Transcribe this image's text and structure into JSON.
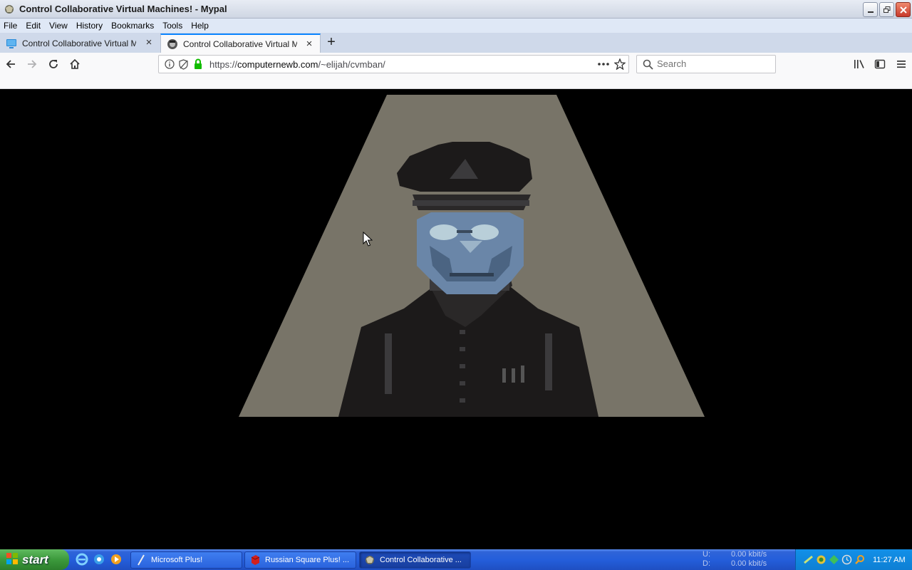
{
  "window": {
    "title": "Control Collaborative Virtual Machines! - Mypal",
    "controls": {
      "minimize": "minimize-icon",
      "restore": "restore-icon",
      "close": "close-icon"
    }
  },
  "menubar": {
    "items": [
      {
        "label": "File",
        "key": "F"
      },
      {
        "label": "Edit",
        "key": "E"
      },
      {
        "label": "View",
        "key": "V"
      },
      {
        "label": "History",
        "key": "H"
      },
      {
        "label": "Bookmarks",
        "key": "B"
      },
      {
        "label": "Tools",
        "key": "T"
      },
      {
        "label": "Help",
        "key": "H"
      }
    ]
  },
  "tabs": [
    {
      "label": "Control Collaborative Virtual Machines!",
      "active": false
    },
    {
      "label": "Control Collaborative Virtual Machines!",
      "active": true
    }
  ],
  "navbar": {
    "url_prefix": "https://",
    "url_host": "computernewb.com",
    "url_path": "/~elijah/cvmban/",
    "search_placeholder": "Search"
  },
  "page": {
    "scene": "pixel-art uniformed officer under spotlight",
    "colors": {
      "background": "#000000",
      "spotlight": "#787468",
      "face": "#6a86a8",
      "uniform": "#1c1a1a"
    }
  },
  "taskbar": {
    "start_label": "start",
    "tasks": [
      {
        "label": "Microsoft Plus!",
        "active": false
      },
      {
        "label": "Russian Square Plus! ...",
        "active": false
      },
      {
        "label": "Control Collaborative ...",
        "active": true
      }
    ],
    "netmon": {
      "up_label": "U:",
      "down_label": "D:",
      "up_value": "0.00 kbit/s",
      "down_value": "0.00 kbit/s"
    },
    "clock": "11:27 AM"
  }
}
